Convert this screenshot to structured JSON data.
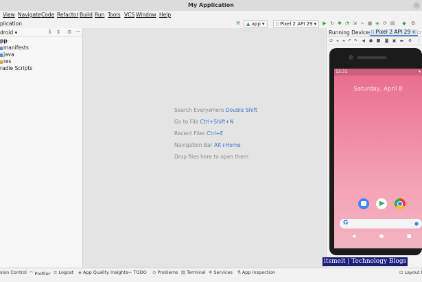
{
  "window": {
    "title": "My Application",
    "minimize_glyph": "–"
  },
  "menu": [
    "View",
    "Navigate",
    "Code",
    "Refactor",
    "Build",
    "Run",
    "Tools",
    "VCS",
    "Window",
    "Help"
  ],
  "toolbar": {
    "breadcrumb": "plication",
    "run_config": "app",
    "device": "Pixel 2 API 29",
    "colors": {
      "run_green": "#3c9a3c",
      "device_icon_blue": "#4a88d0"
    }
  },
  "project": {
    "view_selector": "droid",
    "tree": [
      "pp",
      "manifests",
      "java",
      "res",
      "radle Scripts"
    ]
  },
  "editor": {
    "hints": [
      {
        "text": "Search Everywhere",
        "key": "Double Shift"
      },
      {
        "text": "Go to File",
        "key": "Ctrl+Shift+N"
      },
      {
        "text": "Recent Files",
        "key": "Ctrl+E"
      },
      {
        "text": "Navigation Bar",
        "key": "Alt+Home"
      },
      {
        "text": "Drop files here to open them",
        "key": ""
      }
    ],
    "key_color": "#3d74c9"
  },
  "devices": {
    "title": "Running Devices:",
    "tab": "Pixel 2 API 29",
    "phone": {
      "status_time": "12:31",
      "date": "Saturday, April 8",
      "search_glyph": "G",
      "wallpaper_color": "#f08aa4"
    }
  },
  "watermark": "itsmeit | Technology Blogs",
  "bottom_tabs": [
    "sion Control",
    "Profiler",
    "Logcat",
    "App Quality Insights",
    "TODO",
    "Problems",
    "Terminal",
    "Services",
    "App Inspection"
  ],
  "layout_inspector": "Layout In"
}
